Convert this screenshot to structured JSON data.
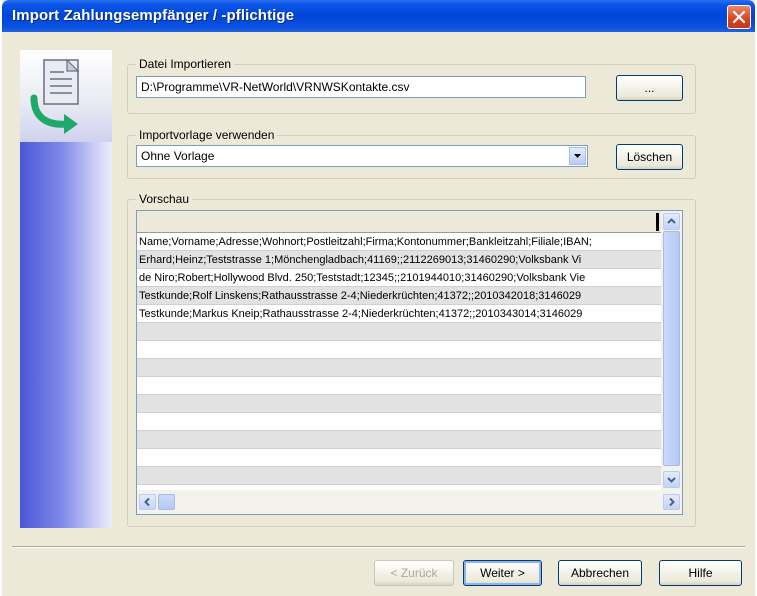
{
  "window": {
    "title": "Import Zahlungsempfänger / -pflichtige"
  },
  "import_file": {
    "group_label": "Datei Importieren",
    "path": "D:\\Programme\\VR-NetWorld\\VRNWSKontakte.csv",
    "browse_label": "..."
  },
  "template": {
    "group_label": "Importvorlage verwenden",
    "selected": "Ohne Vorlage",
    "delete_label": "Löschen"
  },
  "preview": {
    "group_label": "Vorschau",
    "rows": [
      "Name;Vorname;Adresse;Wohnort;Postleitzahl;Firma;Kontonummer;Bankleitzahl;Filiale;IBAN;",
      "Erhard;Heinz;Teststrasse 1;Mönchengladbach;41169;;2112269013;31460290;Volksbank Vi",
      "de Niro;Robert;Hollywood Blvd. 250;Teststadt;12345;;2101944010;31460290;Volksbank Vie",
      "Testkunde;Rolf Linskens;Rathausstrasse 2-4;Niederkrüchten;41372;;2010342018;3146029",
      "Testkunde;Markus Kneip;Rathausstrasse  2-4;Niederkrüchten;41372;;2010343014;3146029",
      "",
      "",
      "",
      "",
      "",
      "",
      "",
      "",
      "",
      ""
    ]
  },
  "footer": {
    "back_label": "< Zurück",
    "next_label": "Weiter >",
    "cancel_label": "Abbrechen",
    "help_label": "Hilfe"
  }
}
